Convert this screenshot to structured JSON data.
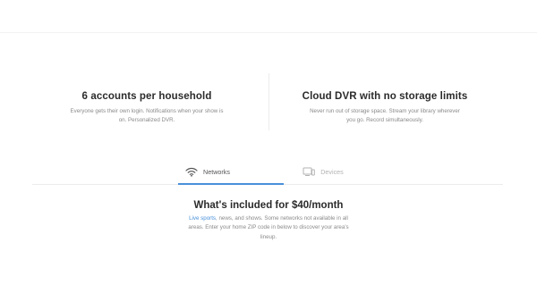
{
  "features": [
    {
      "title": "6 accounts per household",
      "description": "Everyone gets their own login. Notifications when your show is on. Personalized DVR."
    },
    {
      "title": "Cloud DVR with no storage limits",
      "description": "Never run out of storage space. Stream your library wherever you go. Record simultaneously."
    }
  ],
  "tabs": [
    {
      "label": "Networks",
      "icon": "wifi-icon",
      "active": true
    },
    {
      "label": "Devices",
      "icon": "devices-icon",
      "active": false
    }
  ],
  "included": {
    "title": "What's included for $40/month",
    "link_text": "Live sports",
    "body_text": ", news, and shows. Some networks not available in all areas. Enter your home ZIP code in below to discover your area's lineup."
  },
  "colors": {
    "accent": "#4a90d9",
    "heading": "#2b2b2b",
    "body": "#8a8a8a",
    "inactive_tab": "#b3b3b3"
  }
}
